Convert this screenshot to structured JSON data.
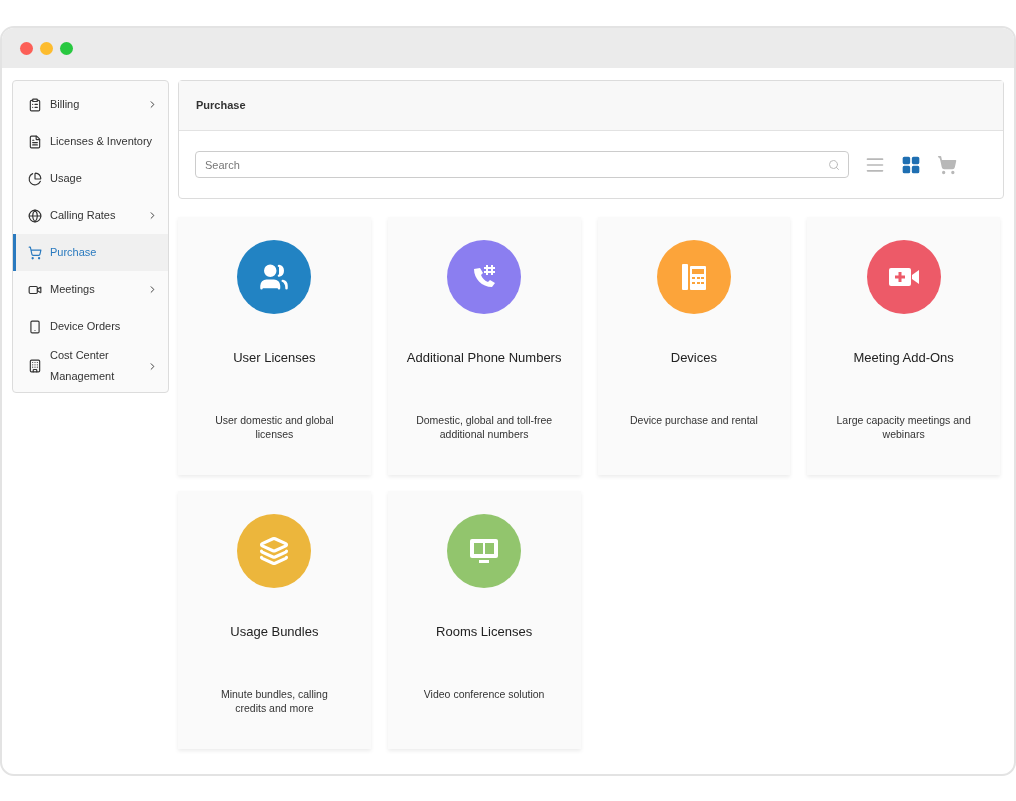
{
  "sidebar": {
    "items": [
      {
        "label": "Billing",
        "has_submenu": true,
        "selected": false
      },
      {
        "label": "Licenses & Inventory",
        "has_submenu": false,
        "selected": false
      },
      {
        "label": "Usage",
        "has_submenu": false,
        "selected": false
      },
      {
        "label": "Calling Rates",
        "has_submenu": true,
        "selected": false
      },
      {
        "label": "Purchase",
        "has_submenu": false,
        "selected": true
      },
      {
        "label": "Meetings",
        "has_submenu": true,
        "selected": false
      },
      {
        "label": "Device Orders",
        "has_submenu": false,
        "selected": false
      },
      {
        "label": "Cost Center Management",
        "has_submenu": true,
        "selected": false
      }
    ]
  },
  "header": {
    "title": "Purchase"
  },
  "search": {
    "placeholder": "Search"
  },
  "view_toggles": [
    {
      "kind": "list",
      "selected": false
    },
    {
      "kind": "grid",
      "selected": true
    },
    {
      "kind": "cart",
      "selected": false
    }
  ],
  "cards": [
    {
      "title": "User Licenses",
      "description": "User domestic and global licenses",
      "color": "#2283c3"
    },
    {
      "title": "Additional Phone Numbers",
      "description": "Domestic, global and toll-free additional numbers",
      "color": "#8b7ef0"
    },
    {
      "title": "Devices",
      "description": "Device purchase and rental",
      "color": "#fca43a"
    },
    {
      "title": "Meeting Add-Ons",
      "description": "Large capacity meetings and webinars",
      "color": "#ed5a68"
    },
    {
      "title": "Usage Bundles",
      "description": "Minute bundles, calling credits and more",
      "color": "#ecb63c"
    },
    {
      "title": "Rooms Licenses",
      "description": "Video conference solution",
      "color": "#92c56d"
    }
  ]
}
